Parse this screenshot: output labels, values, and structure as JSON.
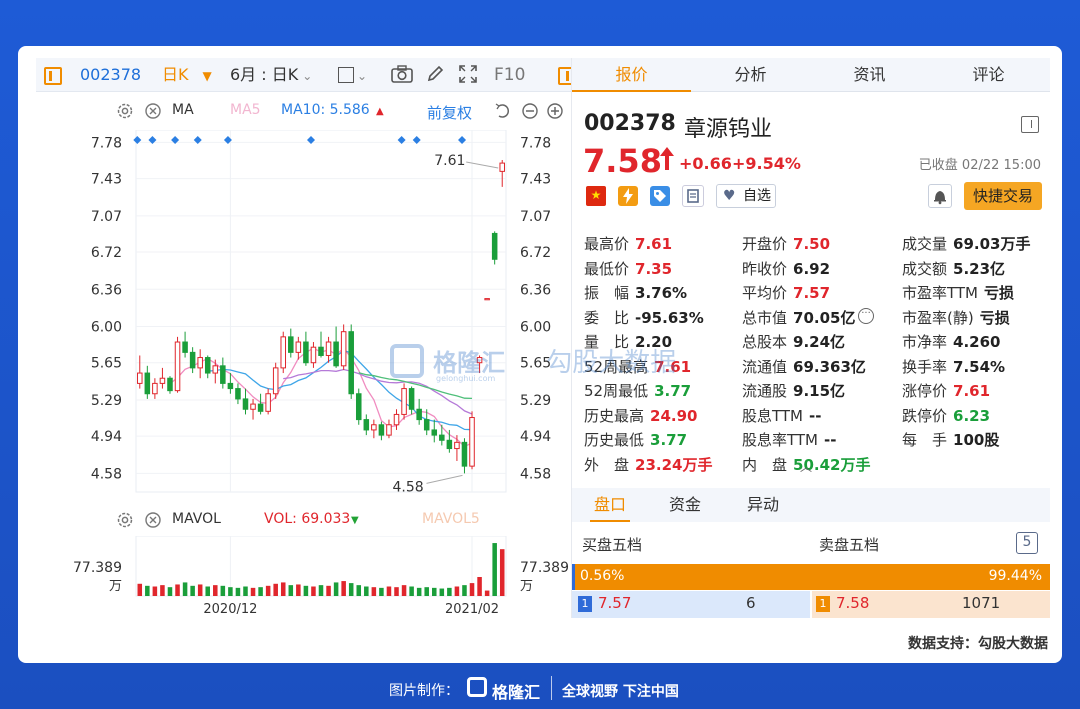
{
  "toolbar": {
    "code": "002378",
    "period": "日K",
    "range": "6月 : 日K",
    "f10": "F10"
  },
  "indicator_main": {
    "name": "MA",
    "ma5_label": "MA5",
    "ma10_label": "MA10: 5.586",
    "adjust_label": "前复权"
  },
  "indicator_vol": {
    "name": "MAVOL",
    "vol_label": "VOL: 69.033",
    "mavol5_label": "MAVOL5"
  },
  "price_axis": {
    "ticks": [
      "7.78",
      "7.43",
      "7.07",
      "6.72",
      "6.36",
      "6.00",
      "5.65",
      "5.29",
      "4.94",
      "4.58"
    ],
    "high_label": "7.61",
    "low_label": "4.58"
  },
  "volume_axis": {
    "value": "77.389",
    "unit": "万"
  },
  "date_axis": {
    "ticks": [
      "2020/12",
      "2021/02"
    ]
  },
  "chart_data": {
    "type": "candlestick",
    "ylim": [
      4.4,
      7.9
    ],
    "candles": [
      [
        5.45,
        5.72,
        5.4,
        5.55
      ],
      [
        5.55,
        5.62,
        5.3,
        5.35
      ],
      [
        5.35,
        5.5,
        5.3,
        5.45
      ],
      [
        5.45,
        5.6,
        5.4,
        5.5
      ],
      [
        5.5,
        5.52,
        5.35,
        5.38
      ],
      [
        5.38,
        5.9,
        5.36,
        5.85
      ],
      [
        5.85,
        5.95,
        5.7,
        5.75
      ],
      [
        5.75,
        5.8,
        5.55,
        5.6
      ],
      [
        5.6,
        5.78,
        5.5,
        5.7
      ],
      [
        5.7,
        5.72,
        5.5,
        5.55
      ],
      [
        5.55,
        5.68,
        5.45,
        5.62
      ],
      [
        5.62,
        5.7,
        5.4,
        5.45
      ],
      [
        5.45,
        5.55,
        5.35,
        5.4
      ],
      [
        5.4,
        5.45,
        5.25,
        5.3
      ],
      [
        5.3,
        5.4,
        5.15,
        5.2
      ],
      [
        5.2,
        5.3,
        5.1,
        5.25
      ],
      [
        5.25,
        5.35,
        5.15,
        5.18
      ],
      [
        5.18,
        5.4,
        5.15,
        5.35
      ],
      [
        5.35,
        5.65,
        5.3,
        5.6
      ],
      [
        5.6,
        5.95,
        5.55,
        5.9
      ],
      [
        5.9,
        5.98,
        5.7,
        5.75
      ],
      [
        5.75,
        5.9,
        5.68,
        5.85
      ],
      [
        5.85,
        5.95,
        5.62,
        5.65
      ],
      [
        5.65,
        5.85,
        5.6,
        5.8
      ],
      [
        5.8,
        5.95,
        5.7,
        5.72
      ],
      [
        5.72,
        5.9,
        5.65,
        5.85
      ],
      [
        5.85,
        6.0,
        5.6,
        5.62
      ],
      [
        5.62,
        6.02,
        5.58,
        5.95
      ],
      [
        5.95,
        6.02,
        5.3,
        5.35
      ],
      [
        5.35,
        5.4,
        5.05,
        5.1
      ],
      [
        5.1,
        5.15,
        4.95,
        5.0
      ],
      [
        5.0,
        5.1,
        4.92,
        5.05
      ],
      [
        5.05,
        5.08,
        4.9,
        4.95
      ],
      [
        4.95,
        5.1,
        4.92,
        5.05
      ],
      [
        5.05,
        5.2,
        5.0,
        5.15
      ],
      [
        5.15,
        5.45,
        5.1,
        5.4
      ],
      [
        5.4,
        5.42,
        5.15,
        5.2
      ],
      [
        5.2,
        5.3,
        5.05,
        5.1
      ],
      [
        5.1,
        5.2,
        4.95,
        5.0
      ],
      [
        5.0,
        5.1,
        4.88,
        4.95
      ],
      [
        4.95,
        5.05,
        4.85,
        4.9
      ],
      [
        4.9,
        5.0,
        4.78,
        4.82
      ],
      [
        4.82,
        4.95,
        4.7,
        4.88
      ],
      [
        4.88,
        4.92,
        4.58,
        4.65
      ],
      [
        4.65,
        5.18,
        4.62,
        5.12
      ],
      [
        5.65,
        5.72,
        5.55,
        5.7
      ],
      [
        6.27,
        6.27,
        6.27,
        6.27
      ],
      [
        6.9,
        6.92,
        6.6,
        6.65
      ],
      [
        7.5,
        7.61,
        7.35,
        7.58
      ]
    ],
    "volumes": [
      18,
      15,
      14,
      16,
      13,
      17,
      20,
      15,
      17,
      14,
      16,
      15,
      13,
      12,
      14,
      12,
      13,
      15,
      18,
      20,
      16,
      17,
      15,
      14,
      16,
      15,
      20,
      22,
      19,
      16,
      14,
      13,
      12,
      14,
      13,
      16,
      14,
      12,
      13,
      12,
      11,
      12,
      14,
      16,
      19,
      28,
      8,
      78,
      69
    ]
  },
  "quote": {
    "tabs": [
      "报价",
      "分析",
      "资讯",
      "评论"
    ],
    "code": "002378",
    "name": "章源钨业",
    "price": "7.58",
    "change": "+0.66",
    "change_pct": "+9.54%",
    "status": "已收盘 02/22 15:00",
    "watch_label": "自选",
    "trade_label": "快捷交易",
    "col1": [
      {
        "label": "最高价",
        "value": "7.61",
        "color": "red"
      },
      {
        "label": "最低价",
        "value": "7.35",
        "color": "red"
      },
      {
        "label": "振　幅",
        "value": "3.76%",
        "color": "dark"
      },
      {
        "label": "委　比",
        "value": "-95.63%",
        "color": "dark"
      },
      {
        "label": "量　比",
        "value": "2.20",
        "color": "dark"
      },
      {
        "label": "52周最高",
        "value": "7.61",
        "color": "red"
      },
      {
        "label": "52周最低",
        "value": "3.77",
        "color": "green"
      },
      {
        "label": "历史最高",
        "value": "24.90",
        "color": "red"
      },
      {
        "label": "历史最低",
        "value": "3.77",
        "color": "green"
      },
      {
        "label": "外　盘",
        "value": "23.24万手",
        "color": "red"
      }
    ],
    "col2": [
      {
        "label": "开盘价",
        "value": "7.50",
        "color": "red"
      },
      {
        "label": "昨收价",
        "value": "6.92",
        "color": "dark"
      },
      {
        "label": "平均价",
        "value": "7.57",
        "color": "red"
      },
      {
        "label": "总市值",
        "value": "70.05亿",
        "color": "dark"
      },
      {
        "label": "总股本",
        "value": "9.24亿",
        "color": "dark"
      },
      {
        "label": "流通值",
        "value": "69.363亿",
        "color": "dark"
      },
      {
        "label": "流通股",
        "value": "9.15亿",
        "color": "dark"
      },
      {
        "label": "股息TTM",
        "value": "--",
        "color": "dark"
      },
      {
        "label": "股息率TTM",
        "value": "--",
        "color": "dark"
      },
      {
        "label": "内　盘",
        "value": "50.42万手",
        "color": "green"
      }
    ],
    "col3": [
      {
        "label": "成交量",
        "value": "69.03万手",
        "color": "dark"
      },
      {
        "label": "成交额",
        "value": "5.23亿",
        "color": "dark"
      },
      {
        "label": "市盈率TTM",
        "value": "亏损",
        "color": "dark"
      },
      {
        "label": "市盈率(静)",
        "value": "亏损",
        "color": "dark"
      },
      {
        "label": "市净率",
        "value": "4.260",
        "color": "dark"
      },
      {
        "label": "换手率",
        "value": "7.54%",
        "color": "dark"
      },
      {
        "label": "涨停价",
        "value": "7.61",
        "color": "red"
      },
      {
        "label": "跌停价",
        "value": "6.23",
        "color": "green"
      },
      {
        "label": "每　手",
        "value": "100股",
        "color": "dark"
      }
    ]
  },
  "book": {
    "tabs": [
      "盘口",
      "资金",
      "异动"
    ],
    "buy_title": "买盘五档",
    "sell_title": "卖盘五档",
    "five_label": "5",
    "buy_pct": "0.56%",
    "sell_pct": "99.44%",
    "buy_pct_value": 0.56,
    "buy_level": "1",
    "buy_price": "7.57",
    "buy_qty": "6",
    "sell_level": "1",
    "sell_price": "7.58",
    "sell_qty": "1071"
  },
  "watermark": {
    "brand": "格隆汇",
    "domain": "gelonghui.com",
    "partner": "勾股大数据"
  },
  "data_support": "数据支持：勾股大数据",
  "footer": {
    "made_by": "图片制作：",
    "brand": "格隆汇",
    "slogan": "全球视野 下注中国"
  },
  "colors": {
    "up": "#e0262c",
    "down": "#1a9e3a",
    "accent": "#f08c00",
    "link": "#1e6fd9"
  }
}
